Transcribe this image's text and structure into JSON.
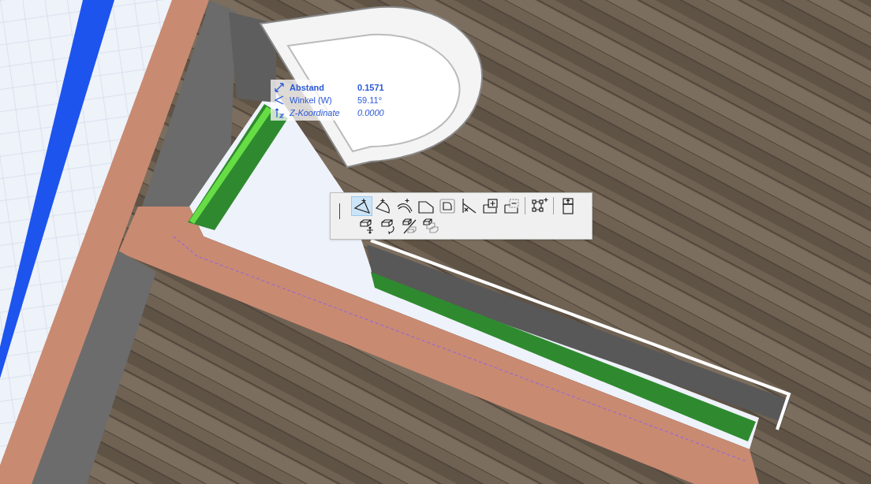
{
  "tracker": {
    "rows": [
      {
        "kind": "distance",
        "label": "Abstand",
        "value": "0.1571"
      },
      {
        "kind": "angle",
        "label": "Winkel (W)",
        "value": "59.11°"
      },
      {
        "kind": "z",
        "label": "Z-Koordinate",
        "value": "0.0000"
      }
    ]
  },
  "pet_palette": {
    "rows": [
      [
        [
          {
            "selected": true
          },
          {
            "selected": false
          },
          {
            "selected": false
          },
          {
            "selected": false
          },
          {
            "selected": false
          },
          {
            "selected": false
          },
          {
            "selected": false
          },
          {
            "selected": false
          }
        ],
        [
          {
            "selected": false
          }
        ],
        [
          {
            "selected": false
          }
        ]
      ],
      [
        [
          {
            "selected": false
          },
          {
            "selected": false
          },
          {
            "selected": false
          },
          {
            "selected": false
          }
        ]
      ]
    ]
  }
}
